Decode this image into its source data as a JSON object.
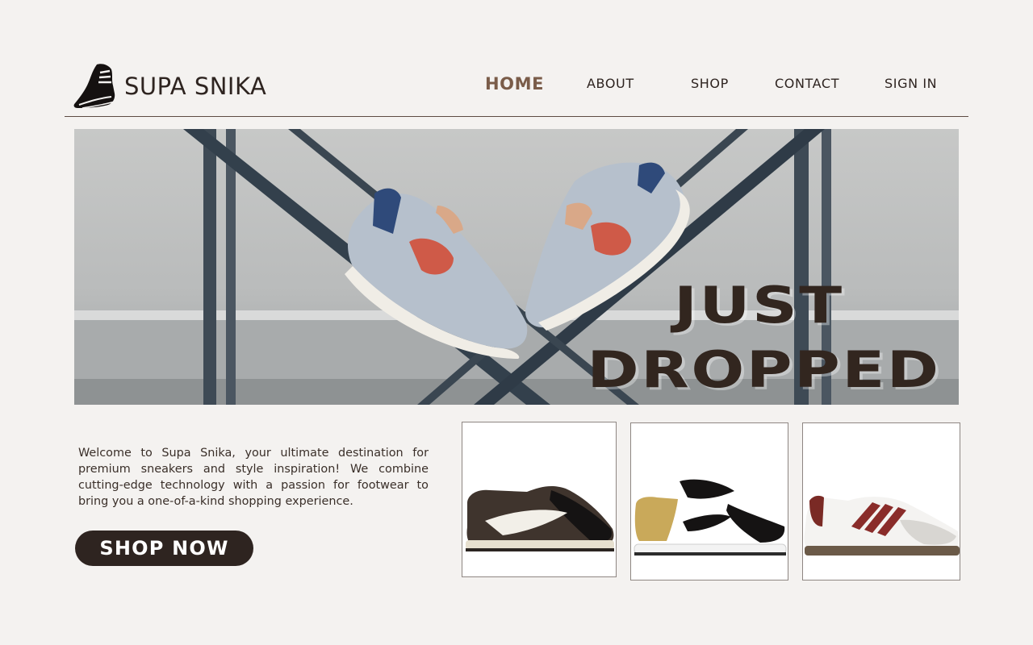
{
  "brand": {
    "name": "SUPA SNIKA",
    "logo_icon": "running-shoe-icon"
  },
  "nav": {
    "home": "HOME",
    "about": "ABOUT",
    "shop": "SHOP",
    "contact": "CONTACT",
    "sign_in": "SIGN IN",
    "active": "HOME"
  },
  "hero": {
    "headline_line1": "JUST",
    "headline_line2": "DROPPED"
  },
  "intro": {
    "text": "Welcome to Supa Snika, your ultimate destination for premium sneakers and style inspiration! We combine cutting-edge technology with a passion for footwear to bring you a one-of-a-kind shopping experience."
  },
  "cta": {
    "label": "SHOP NOW"
  },
  "products": [
    {
      "icon": "sneaker-brown-black-icon"
    },
    {
      "icon": "sneaker-gold-black-icon"
    },
    {
      "icon": "sneaker-white-red-stripes-icon"
    }
  ],
  "colors": {
    "background": "#f4f2f0",
    "primary_dark": "#2e2420",
    "nav_active": "#7a5c49"
  }
}
